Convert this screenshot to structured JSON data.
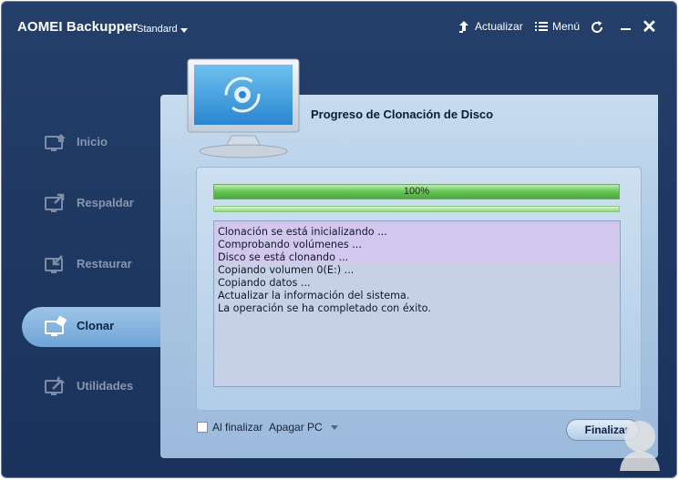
{
  "titlebar": {
    "app_name": "AOMEI Backupper",
    "edition": "Standard",
    "upgrade_label": "Actualizar",
    "menu_label": "Menú"
  },
  "sidebar": {
    "items": [
      {
        "label": "Inicio",
        "icon": "home-icon",
        "active": false
      },
      {
        "label": "Respaldar",
        "icon": "backup-icon",
        "active": false
      },
      {
        "label": "Restaurar",
        "icon": "restore-icon",
        "active": false
      },
      {
        "label": "Clonar",
        "icon": "clone-icon",
        "active": true
      },
      {
        "label": "Utilidades",
        "icon": "tools-icon",
        "active": false
      }
    ]
  },
  "main": {
    "title": "Progreso de Clonación de Disco",
    "progress": {
      "text": "100%",
      "percent": 100
    },
    "log_lines": [
      "Clonación se está inicializando ...",
      "Comprobando volúmenes ...",
      "Disco se está clonando ...",
      "Copiando volumen 0(E:) ...",
      "Copiando datos ...",
      "Actualizar la información del sistema.",
      "La operación se ha completado con éxito."
    ],
    "after_finish_label": "Al finalizar",
    "after_finish_option": "Apagar PC",
    "after_finish_checked": false,
    "finish_button": "Finalizar"
  },
  "colors": {
    "window_bg": "#1f3963",
    "panel_bg": "#b4cde6",
    "progress_fill": "#5cbf4e",
    "accent": "#6fa3d6"
  }
}
